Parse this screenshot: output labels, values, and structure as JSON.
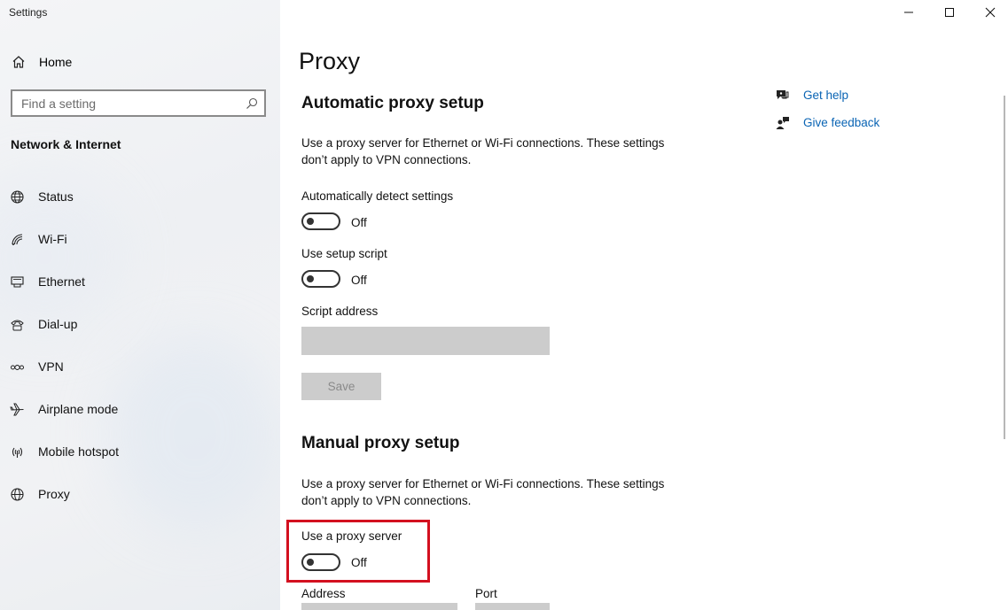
{
  "window": {
    "title": "Settings",
    "controls": [
      "minimize-icon",
      "maximize-icon",
      "close-icon"
    ]
  },
  "sidebar": {
    "home_label": "Home",
    "search_placeholder": "Find a setting",
    "section_title": "Network & Internet",
    "items": [
      {
        "label": "Status",
        "icon": "status-globe-icon"
      },
      {
        "label": "Wi-Fi",
        "icon": "wifi-icon"
      },
      {
        "label": "Ethernet",
        "icon": "ethernet-icon"
      },
      {
        "label": "Dial-up",
        "icon": "dialup-icon"
      },
      {
        "label": "VPN",
        "icon": "vpn-icon"
      },
      {
        "label": "Airplane mode",
        "icon": "airplane-icon"
      },
      {
        "label": "Mobile hotspot",
        "icon": "hotspot-icon"
      },
      {
        "label": "Proxy",
        "icon": "proxy-globe-icon"
      }
    ]
  },
  "main": {
    "page_title": "Proxy",
    "automatic": {
      "heading": "Automatic proxy setup",
      "description_line1": "Use a proxy server for Ethernet or Wi-Fi connections. These settings",
      "description_line2": "don’t apply to VPN connections.",
      "detect_label": "Automatically detect settings",
      "detect_state": "Off",
      "script_label": "Use setup script",
      "script_state": "Off",
      "script_address_label": "Script address",
      "script_address_value": "",
      "save_label": "Save"
    },
    "manual": {
      "heading": "Manual proxy setup",
      "description_line1": "Use a proxy server for Ethernet or Wi-Fi connections. These settings",
      "description_line2": "don’t apply to VPN connections.",
      "use_proxy_label": "Use a proxy server",
      "use_proxy_state": "Off",
      "address_label": "Address",
      "port_label": "Port"
    },
    "help": {
      "get_help": "Get help",
      "give_feedback": "Give feedback"
    }
  },
  "colors": {
    "link": "#0a64b4",
    "highlight_box": "#d3101f",
    "disabled_field": "#cccccc"
  }
}
